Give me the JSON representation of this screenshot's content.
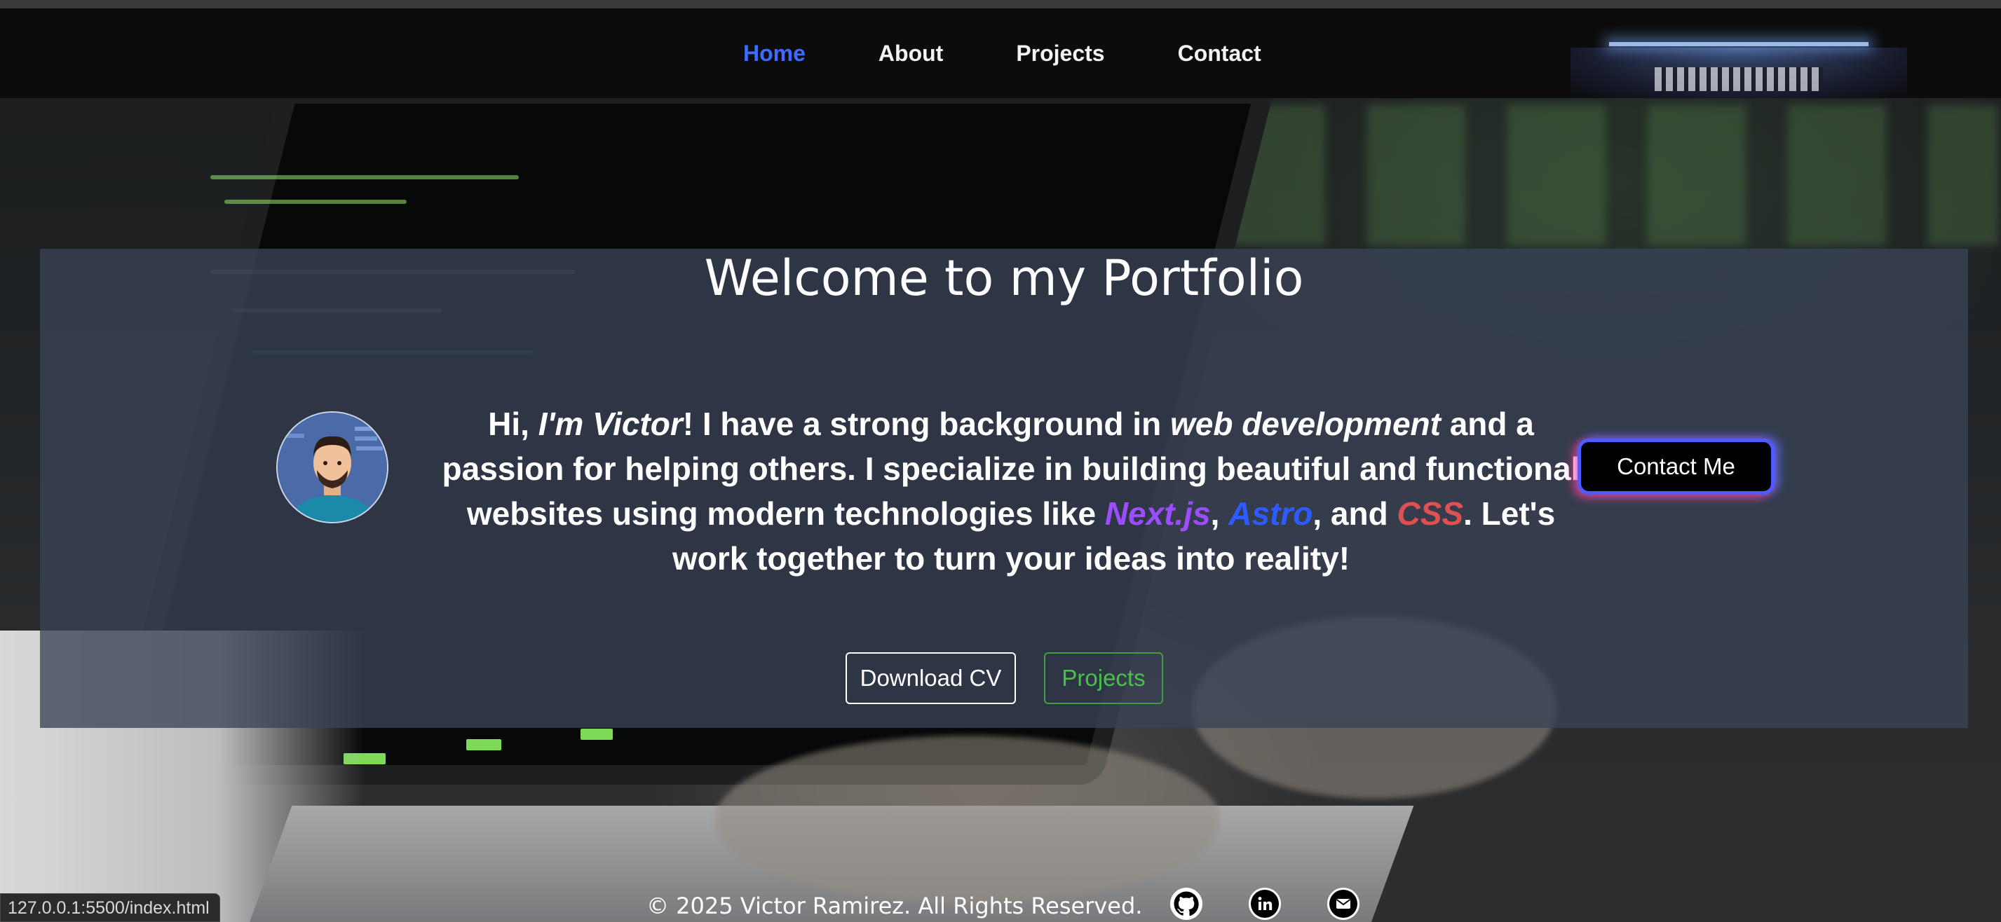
{
  "nav": {
    "links": [
      {
        "label": "Home",
        "active": true
      },
      {
        "label": "About"
      },
      {
        "label": "Projects"
      },
      {
        "label": "Contact"
      }
    ]
  },
  "hero": {
    "title": "Welcome to my Portfolio",
    "intro": {
      "p1": "Hi, ",
      "name": "I'm Victor",
      "p2": "! I have a strong background in ",
      "field": "web development",
      "p3": " and a passion for helping others. I specialize in building beautiful and functional websites using modern technologies like ",
      "tech1": "Next.js",
      "sep1": ", ",
      "tech2": "Astro",
      "sep2": ", and ",
      "tech3": "CSS",
      "p4": ". Let's work together to turn your ideas into reality!"
    },
    "contact_button": "Contact Me",
    "download_cv_button": "Download CV",
    "projects_button": "Projects"
  },
  "footer": {
    "copyright": "© 2025 Victor Ramirez. All Rights Reserved.",
    "socials": [
      {
        "icon": "github-icon"
      },
      {
        "icon": "linkedin-icon"
      },
      {
        "icon": "mail-icon"
      }
    ]
  },
  "status_bar": {
    "url": "127.0.0.1:5500/index.html"
  },
  "colors": {
    "nav_active": "#3f6bff",
    "next_js": "#9b4dff",
    "astro": "#2d5bff",
    "css": "#e05050",
    "projects_button": "#49c049"
  }
}
